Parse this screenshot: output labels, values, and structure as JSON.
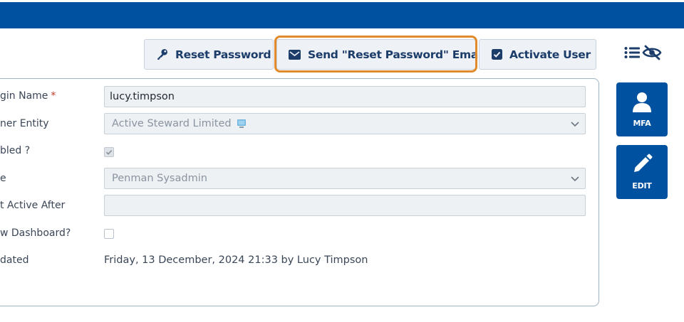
{
  "toolbar": {
    "reset_password_label": "Reset Password",
    "send_reset_email_label": "Send \"Reset Password\" Email",
    "activate_user_label": "Activate User"
  },
  "form": {
    "login_name": {
      "label": "gin Name",
      "required_mark": "*",
      "value": "lucy.timpson"
    },
    "owner_entity": {
      "label": "ner Entity",
      "value": "Active Steward Limited"
    },
    "enabled": {
      "label": "bled ?",
      "checked": true
    },
    "role": {
      "label": "e",
      "value": "Penman Sysadmin"
    },
    "not_active_after": {
      "label": "t Active After",
      "value": ""
    },
    "show_dashboard": {
      "label": "w Dashboard?",
      "checked": false
    },
    "updated": {
      "label": "dated",
      "value": "Friday, 13 December, 2024 21:33 by Lucy Timpson"
    }
  },
  "side_actions": {
    "mfa_label": "MFA",
    "edit_label": "EDIT"
  },
  "icons": {
    "reset_password": "key-icon",
    "send_email": "envelope-icon",
    "activate_user": "check-square-icon",
    "list": "list-icon",
    "visibility": "eye-slash-icon",
    "entity": "computer-icon",
    "mfa": "user-icon",
    "edit": "pencil-icon",
    "dropdown": "chevron-down-icon"
  },
  "colors": {
    "brand": "#0052a0",
    "highlight": "#e08a2c",
    "required": "#c0392b",
    "button_text": "#1c3d6a"
  }
}
